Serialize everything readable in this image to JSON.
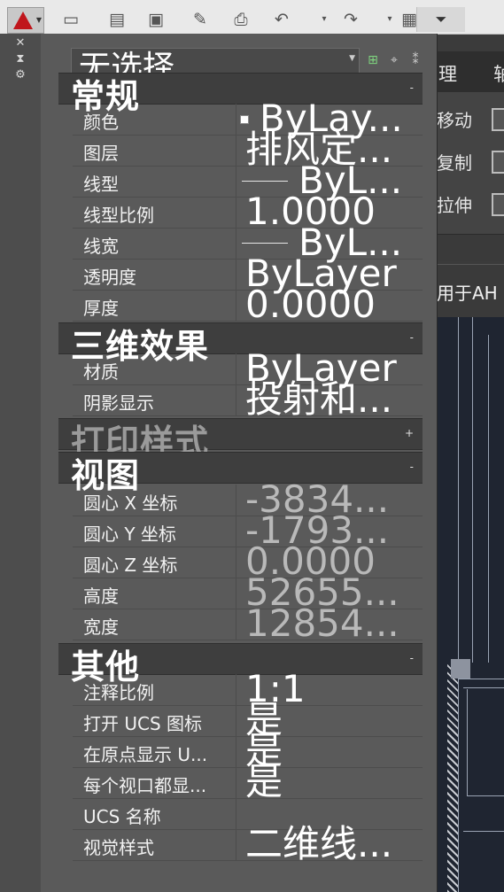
{
  "toolbar": {
    "quick_access_icons": [
      "new-icon",
      "open-icon",
      "save-icon",
      "save-as-icon",
      "plot-icon",
      "undo-icon",
      "redo-icon",
      "workspace-icon"
    ],
    "menu_caret": "⏷"
  },
  "ribbon": {
    "tab_partial_1": "理",
    "tab_partial_2": "轴",
    "commands": [
      "移动",
      "复制",
      "拉伸"
    ]
  },
  "document_tab": {
    "label": "用于AH"
  },
  "palette": {
    "selector_value": "无选择",
    "sections": [
      {
        "title": "常规",
        "toggle": "-",
        "rows": [
          {
            "name": "颜色",
            "value": "ByLay..."
          },
          {
            "name": "图层",
            "value": "排风定..."
          },
          {
            "name": "线型",
            "value": "ByL..."
          },
          {
            "name": "线型比例",
            "value": "1.0000"
          },
          {
            "name": "线宽",
            "value": "ByL..."
          },
          {
            "name": "透明度",
            "value": "ByLayer"
          },
          {
            "name": "厚度",
            "value": "0.0000"
          }
        ]
      },
      {
        "title": "三维效果",
        "toggle": "-",
        "rows": [
          {
            "name": "材质",
            "value": "ByLayer"
          },
          {
            "name": "阴影显示",
            "value": "投射和..."
          }
        ]
      },
      {
        "title": "打印样式",
        "toggle": "+",
        "rows": []
      },
      {
        "title": "视图",
        "toggle": "-",
        "rows": [
          {
            "name": "圆心 X 坐标",
            "value": "-3834..."
          },
          {
            "name": "圆心 Y 坐标",
            "value": "-1793..."
          },
          {
            "name": "圆心 Z 坐标",
            "value": "0.0000"
          },
          {
            "name": "高度",
            "value": "52655..."
          },
          {
            "name": "宽度",
            "value": "12854..."
          }
        ]
      },
      {
        "title": "其他",
        "toggle": "-",
        "rows": [
          {
            "name": "注释比例",
            "value": "1:1"
          },
          {
            "name": "打开 UCS 图标",
            "value": "是"
          },
          {
            "name": "在原点显示 U...",
            "value": "是"
          },
          {
            "name": "每个视口都显...",
            "value": "是"
          },
          {
            "name": "UCS 名称",
            "value": ""
          },
          {
            "name": "视觉样式",
            "value": "二维线..."
          }
        ]
      }
    ]
  },
  "colors": {
    "palette_bg": "#5a5a5a",
    "section_bg": "#3e3e3e",
    "app_logo": "#c0161c",
    "drawing_bg": "#1f2531"
  }
}
